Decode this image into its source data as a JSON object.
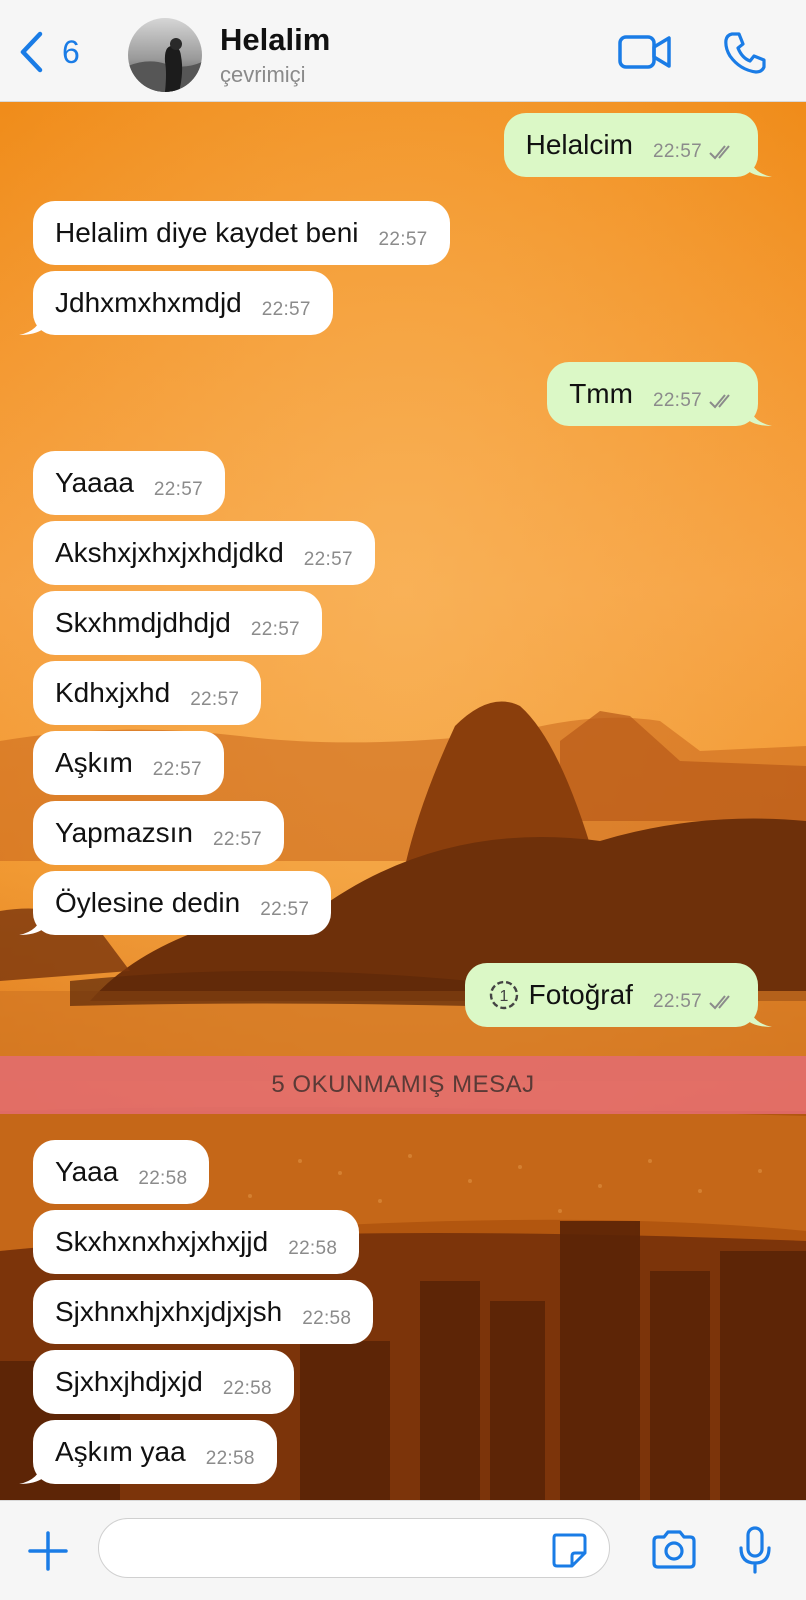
{
  "header": {
    "back_count": "6",
    "contact_name": "Helalim",
    "status": "çevrimiçi"
  },
  "messages": [
    {
      "dir": "out",
      "text": "Helalcim",
      "time": "22:57",
      "read": true
    },
    {
      "dir": "in",
      "text": "Helalim diye kaydet  beni",
      "time": "22:57"
    },
    {
      "dir": "in",
      "text": "Jdhxmxhxmdjd",
      "time": "22:57"
    },
    {
      "dir": "out",
      "text": "Tmm",
      "time": "22:57",
      "read": true
    },
    {
      "dir": "in",
      "text": "Yaaaa",
      "time": "22:57"
    },
    {
      "dir": "in",
      "text": "Akshxjxhxjxhdjdkd",
      "time": "22:57"
    },
    {
      "dir": "in",
      "text": "Skxhmdjdhdjd",
      "time": "22:57"
    },
    {
      "dir": "in",
      "text": "Kdhxjxhd",
      "time": "22:57"
    },
    {
      "dir": "in",
      "text": "Aşkım",
      "time": "22:57"
    },
    {
      "dir": "in",
      "text": "Yapmazsın",
      "time": "22:57"
    },
    {
      "dir": "in",
      "text": "Öylesine dedin",
      "time": "22:57"
    },
    {
      "dir": "out",
      "text": "Fotoğraf",
      "time": "22:57",
      "read": true,
      "icon": "view-once-icon"
    },
    {
      "dir": "in",
      "text": "Yaaa",
      "time": "22:58"
    },
    {
      "dir": "in",
      "text": "Skxhxnxhxjxhxjjd",
      "time": "22:58"
    },
    {
      "dir": "in",
      "text": "Sjxhnxhjxhxjdjxjsh",
      "time": "22:58"
    },
    {
      "dir": "in",
      "text": "Sjxhxjhdjxjd",
      "time": "22:58"
    },
    {
      "dir": "in",
      "text": "Aşkım yaa",
      "time": "22:58"
    }
  ],
  "unread_banner": "5 OKUNMAMIŞ MESAJ",
  "composer": {
    "value": "",
    "placeholder": ""
  },
  "colors": {
    "accent": "#1a7ce6",
    "outgoing_bubble": "#dbf8c6",
    "incoming_bubble": "#ffffff",
    "unread_banner": "#e26c70"
  }
}
